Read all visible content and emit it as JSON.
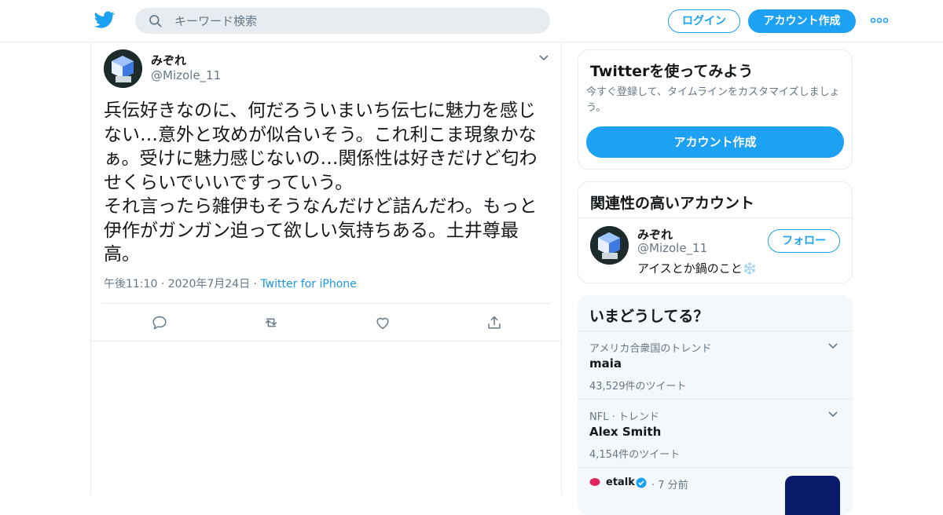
{
  "header": {
    "search_placeholder": "キーワード検索",
    "login_label": "ログイン",
    "signup_label": "アカウント作成",
    "logo_icon": "twitter-bird-icon",
    "more_icon": "more-dots-icon",
    "brand_color": "#1da1f2"
  },
  "tweet": {
    "author_name": "みぞれ",
    "author_handle": "@Mizole_11",
    "text": "兵伝好きなのに、何だろういまいち伝七に魅力を感じない…意外と攻めが似合いそう。これ利こま現象かなぁ。受けに魅力感じないの…関係性は好きだけど匂わせくらいでいいですっていう。\nそれ言ったら雑伊もそうなんだけど詰んだわ。もっと伊作がガンガン迫って欲しい気持ちある。土井尊最高。",
    "time": "午後11:10",
    "date": "2020年7月24日",
    "source": "Twitter for iPhone",
    "sep": "·",
    "actions": [
      "reply-icon",
      "retweet-icon",
      "like-icon",
      "share-icon"
    ]
  },
  "sidebar": {
    "signup_card": {
      "title": "Twitterを使ってみよう",
      "subtitle": "今すぐ登録して、タイムラインをカスタマイズしましょう。",
      "button": "アカウント作成"
    },
    "related_card": {
      "title": "関連性の高いアカウント",
      "name": "みぞれ",
      "handle": "@Mizole_11",
      "bio": "アイスとか鍋のこと❄️",
      "follow": "フォロー"
    },
    "trends_card": {
      "title": "いまどうしてる？",
      "trends": [
        {
          "context": "アメリカ合衆国のトレンド",
          "title": "maia",
          "count": "43,529件のツイート"
        },
        {
          "context": "NFL · トレンド",
          "title": "Alex Smith",
          "count": "4,154件のツイート"
        }
      ],
      "news": {
        "source": "etalk",
        "time": "· 7 分前"
      }
    }
  }
}
